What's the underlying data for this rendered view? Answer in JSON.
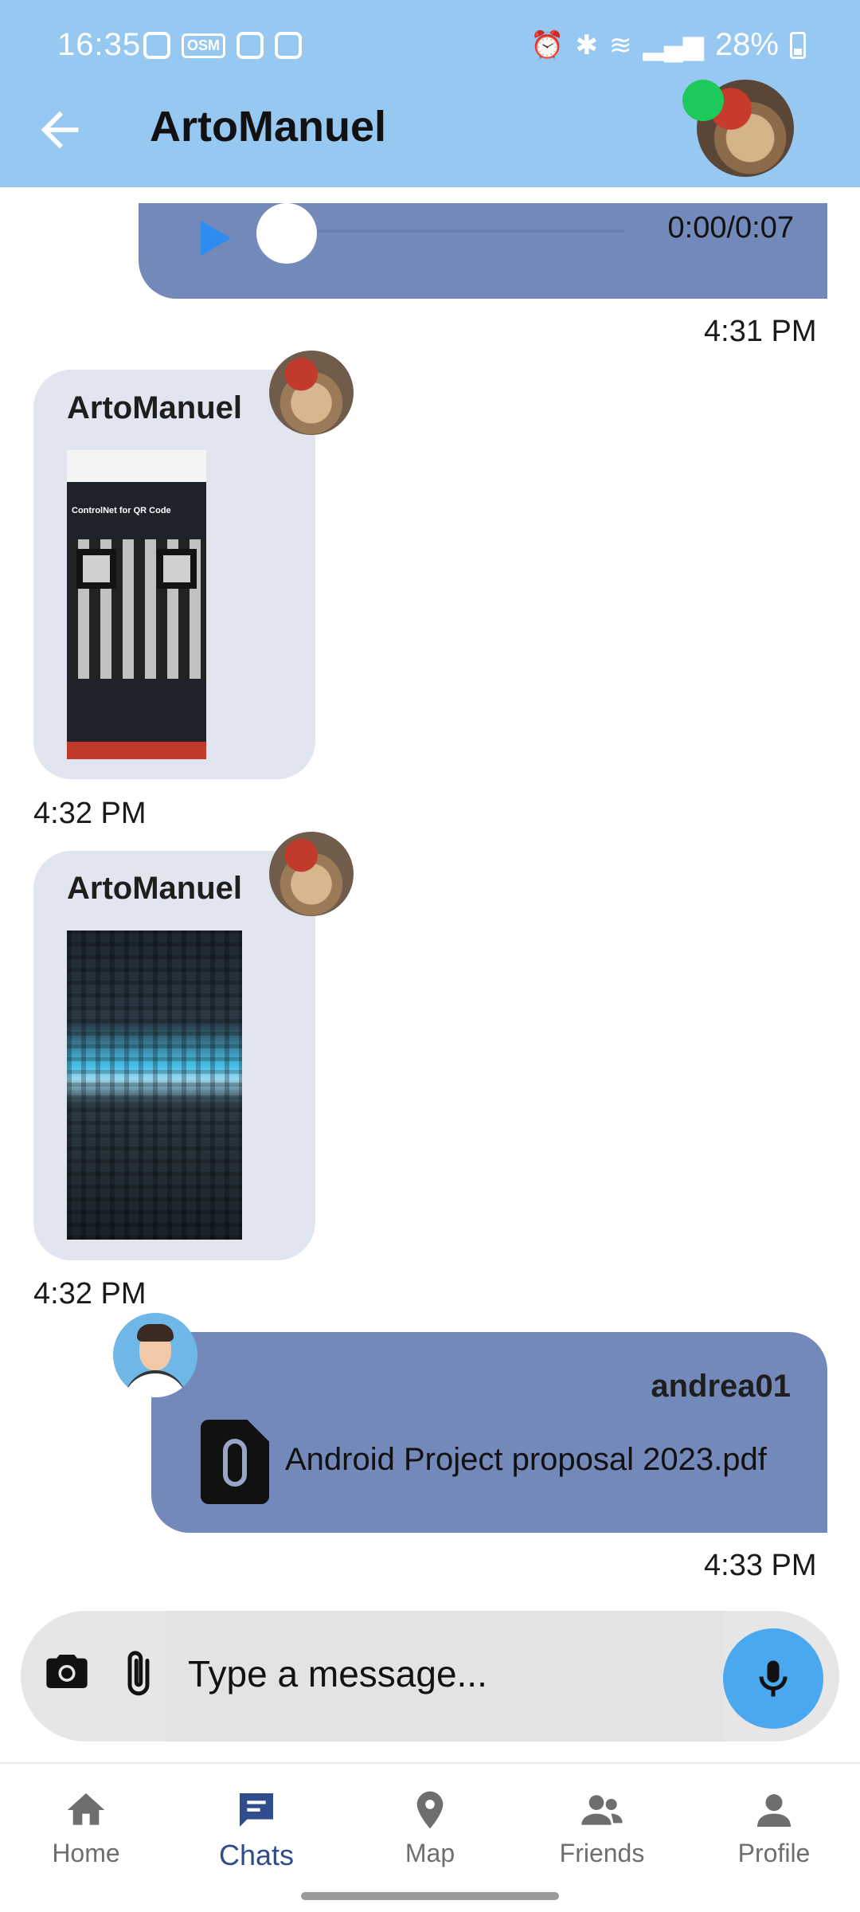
{
  "status_bar": {
    "time": "16:35",
    "battery": "28%",
    "osm_badge": "OSM"
  },
  "header": {
    "title": "ArtoManuel",
    "back_icon": "arrow-left-icon",
    "online_color": "#1ec95b",
    "background": "#97c8f2"
  },
  "messages": [
    {
      "type": "audio",
      "direction": "outgoing",
      "duration": "0:00/0:07",
      "time": "4:31 PM"
    },
    {
      "type": "image",
      "direction": "incoming",
      "sender": "ArtoManuel",
      "image_text": "ControlNet for QR Code",
      "time": "4:32 PM"
    },
    {
      "type": "image",
      "direction": "incoming",
      "sender": "ArtoManuel",
      "time": "4:32 PM"
    },
    {
      "type": "file",
      "direction": "outgoing",
      "sender": "andrea01",
      "file_name": "Android Project proposal 2023.pdf",
      "time": "4:33 PM"
    }
  ],
  "composer": {
    "placeholder": "Type a message...",
    "camera_icon": "camera-icon",
    "attach_icon": "paperclip-icon",
    "mic_icon": "microphone-icon",
    "mic_color": "#4aa8ee"
  },
  "nav": {
    "items": [
      {
        "label": "Home",
        "icon": "home-icon"
      },
      {
        "label": "Chats",
        "icon": "chat-icon",
        "active": true
      },
      {
        "label": "Map",
        "icon": "map-pin-icon"
      },
      {
        "label": "Friends",
        "icon": "friends-icon"
      },
      {
        "label": "Profile",
        "icon": "profile-icon"
      }
    ],
    "active_color": "#2f4c8c"
  }
}
